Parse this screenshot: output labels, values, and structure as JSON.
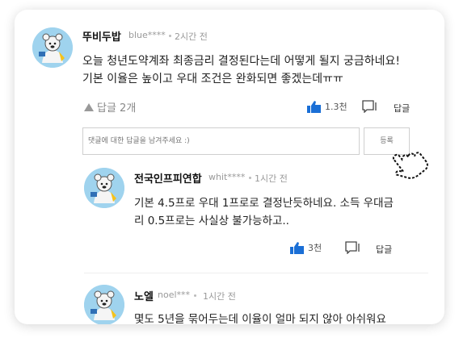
{
  "comments": [
    {
      "name": "뚜비두밥",
      "user_id": "blue****",
      "time": "2시간 전",
      "text_line1": "오늘 청년도약계좌 최종금리 결정된다는데 어떻게 될지 궁금하네요!",
      "text_line2": "기본 이율은 높이고 우대 조건은 완화되면 좋겠는데ㅠㅠ",
      "reply_toggle": "답글 2개",
      "likes": "1.3천",
      "reply_label": "답글"
    },
    {
      "name": "전국인프피연합",
      "user_id": "whit****",
      "time": "1시간 전",
      "text_line1": "기본 4.5프로 우대 1프로로 결정난듯하네요. 소득 우대금",
      "text_line2": "리 0.5프로는 사실상 불가능하고..",
      "likes": "3천",
      "reply_label": "답글"
    },
    {
      "name": "노엘",
      "user_id": "noel***",
      "time": "1시간 전",
      "text_line1": "몇도 5년을 묶어두는데 이율이 얼마 되지 않아 아쉬워요"
    }
  ],
  "reply_input": {
    "placeholder": "댓글에 대한 답글을 남겨주세요 :)",
    "submit_label": "등록"
  },
  "colors": {
    "accent": "#1a6fd6",
    "avatar_bg": "#9fd3ee"
  },
  "icons": [
    "thumbs-up-icon",
    "comment-icon",
    "triangle-up-icon",
    "hand-cursor-icon"
  ]
}
